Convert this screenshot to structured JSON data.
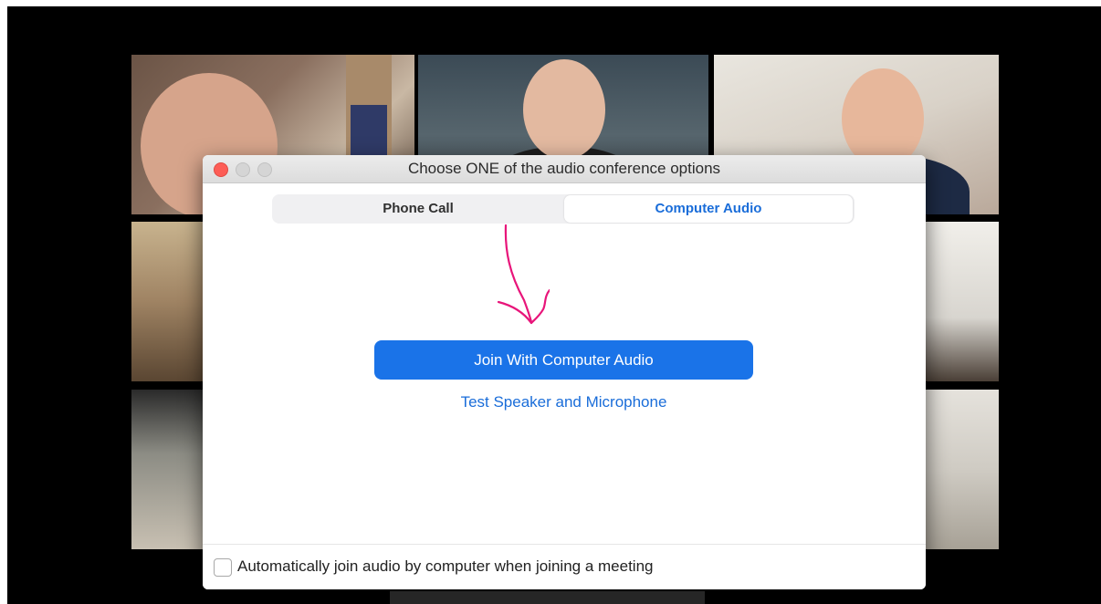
{
  "dialog": {
    "title": "Choose ONE of the audio conference options",
    "tabs": [
      {
        "label": "Phone Call",
        "selected": false
      },
      {
        "label": "Computer Audio",
        "selected": true
      }
    ],
    "join_button_label": "Join With Computer Audio",
    "test_link_label": "Test Speaker and Microphone",
    "auto_join": {
      "label": "Automatically join audio by computer when joining a meeting",
      "checked": false
    }
  },
  "colors": {
    "accent": "#1a73e8",
    "link": "#1a6dd9",
    "annotation": "#e8157a",
    "close_button": "#fd5d56"
  },
  "icons": {
    "annotation": "hand-drawn-arrow-icon"
  }
}
